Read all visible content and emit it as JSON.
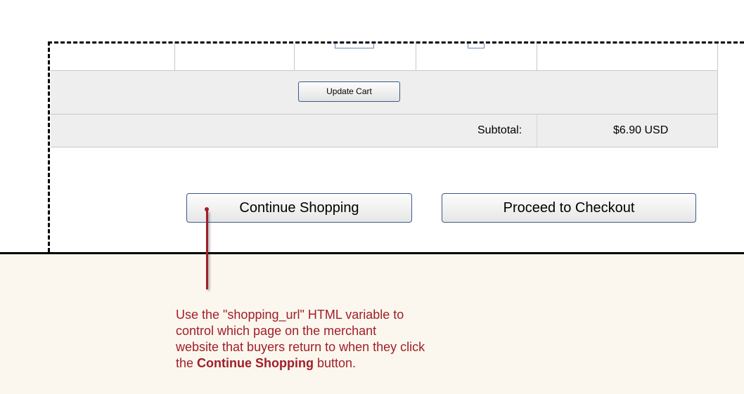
{
  "cart": {
    "update_button": "Update Cart",
    "subtotal_label": "Subtotal:",
    "subtotal_value": "$6.90 USD"
  },
  "actions": {
    "continue_label": "Continue Shopping",
    "checkout_label": "Proceed to Checkout"
  },
  "annotation": {
    "line1": "Use the \"shopping_url\" HTML variable to",
    "line2": "control which page on the merchant",
    "line3": "website that buyers return to when they click",
    "line4_pre": "the ",
    "line4_bold": "Continue Shopping",
    "line4_post": " button."
  },
  "colors": {
    "annotation_text": "#a01e28",
    "annotation_bg": "#fbf7ee",
    "row_bg": "#eeeeee"
  }
}
